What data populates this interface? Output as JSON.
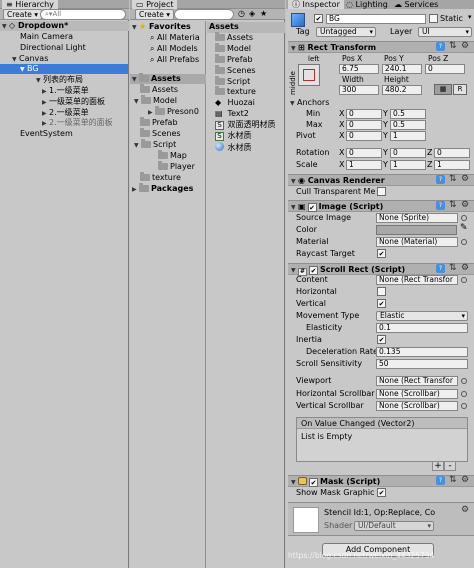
{
  "hierarchy": {
    "tab_label": "Hierarchy",
    "create_label": "Create",
    "search_placeholder": "All",
    "scene_label": "Dropdown*",
    "items": [
      {
        "label": "Main Camera"
      },
      {
        "label": "Directional Light"
      },
      {
        "label": "Canvas"
      },
      {
        "label": "BG"
      },
      {
        "label": "列表的布局"
      },
      {
        "label": "1.一级菜单"
      },
      {
        "label": "一级菜单的面板"
      },
      {
        "label": "2.一级菜单"
      },
      {
        "label": "2.一级菜单的面板"
      },
      {
        "label": "EventSystem"
      }
    ]
  },
  "project": {
    "tab_label": "Project",
    "create_label": "Create",
    "favorites": {
      "label": "Favorites",
      "items": [
        "All Materia",
        "All Models",
        "All Prefabs"
      ]
    },
    "assets_tree": {
      "label": "Assets",
      "items": [
        "Assets",
        "Model",
        "Preson0",
        "Prefab",
        "Scenes",
        "Script",
        "Map",
        "Player",
        "texture"
      ],
      "packages_label": "Packages"
    },
    "assets_panel": {
      "label": "Assets",
      "items": [
        "Assets",
        "Model",
        "Prefab",
        "Scenes",
        "Script",
        "texture",
        "Huozai",
        "Text2",
        "双面透明材质",
        "水材质",
        "水材质"
      ]
    }
  },
  "inspector": {
    "tabs": [
      "Inspector",
      "Lighting",
      "Services"
    ],
    "object_name": "BG",
    "static_label": "Static",
    "tag_label": "Tag",
    "tag_value": "Untagged",
    "layer_label": "Layer",
    "layer_value": "UI",
    "rect_transform": {
      "title": "Rect Transform",
      "anchor_h": "left",
      "anchor_v": "middle",
      "pos_x_label": "Pos X",
      "pos_y_label": "Pos Y",
      "pos_z_label": "Pos Z",
      "pos_x": "6.75",
      "pos_y": "240.1",
      "pos_z": "0",
      "width_label": "Width",
      "height_label": "Height",
      "width": "300",
      "height": "480.2",
      "r_button": "R",
      "anchors_label": "Anchors",
      "min_label": "Min",
      "max_label": "Max",
      "pivot_label": "Pivot",
      "min_x": "0",
      "min_y": "0.5",
      "max_x": "0",
      "max_y": "0.5",
      "pivot_x": "0",
      "pivot_y": "1",
      "rotation_label": "Rotation",
      "scale_label": "Scale",
      "rot_x": "0",
      "rot_y": "0",
      "rot_z": "0",
      "scale_x": "1",
      "scale_y": "1",
      "scale_z": "1"
    },
    "canvas_renderer": {
      "title": "Canvas Renderer",
      "cull_label": "Cull Transparent Me"
    },
    "image": {
      "title": "Image (Script)",
      "source_label": "Source Image",
      "source_value": "None (Sprite)",
      "color_label": "Color",
      "material_label": "Material",
      "material_value": "None (Material)",
      "raycast_label": "Raycast Target",
      "color_hex": "#a8a8a8"
    },
    "scroll_rect": {
      "title": "Scroll Rect (Script)",
      "content_label": "Content",
      "content_value": "None (Rect Transfor",
      "horizontal_label": "Horizontal",
      "vertical_label": "Vertical",
      "movement_label": "Movement Type",
      "movement_value": "Elastic",
      "elasticity_label": "Elasticity",
      "elasticity_value": "0.1",
      "inertia_label": "Inertia",
      "decel_label": "Deceleration Rate",
      "decel_value": "0.135",
      "sensitivity_label": "Scroll Sensitivity",
      "sensitivity_value": "50",
      "viewport_label": "Viewport",
      "viewport_value": "None (Rect Transfor",
      "hscroll_label": "Horizontal Scrollbar",
      "hscroll_value": "None (Scrollbar)",
      "vscroll_label": "Vertical Scrollbar",
      "vscroll_value": "None (Scrollbar)",
      "event_title": "On Value Changed (Vector2)",
      "event_list": "List is Empty",
      "plus": "+",
      "minus": "-"
    },
    "mask": {
      "title": "Mask (Script)",
      "show_graphic_label": "Show Mask Graphic"
    },
    "material_preview": {
      "stencil": "Stencil Id:1, Op:Replace, Co",
      "shader_label": "Shader",
      "shader_value": "UI/Default"
    },
    "add_component": "Add Component",
    "watermark": "https://blog.csdn.net/weixin_44325794"
  }
}
